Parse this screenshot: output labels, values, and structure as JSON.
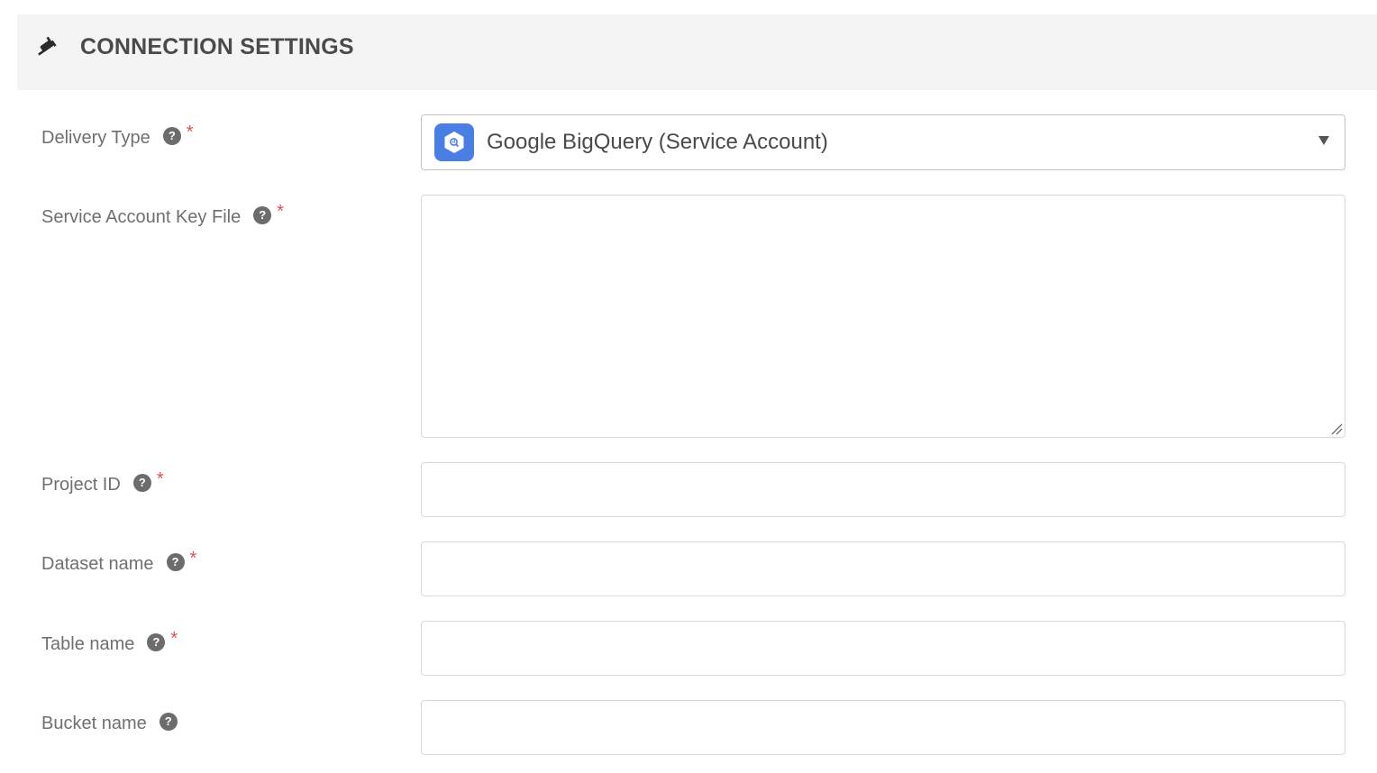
{
  "header": {
    "icon": "plug-icon",
    "title": "CONNECTION SETTINGS"
  },
  "fields": {
    "delivery_type": {
      "label": "Delivery Type",
      "required": "*",
      "help": "?",
      "value": "Google BigQuery (Service Account)",
      "icon": "bigquery-logo-icon"
    },
    "service_account_key_file": {
      "label": "Service Account Key File",
      "required": "*",
      "help": "?",
      "value": ""
    },
    "project_id": {
      "label": "Project ID",
      "required": "*",
      "help": "?",
      "value": ""
    },
    "dataset_name": {
      "label": "Dataset name",
      "required": "*",
      "help": "?",
      "value": ""
    },
    "table_name": {
      "label": "Table name",
      "required": "*",
      "help": "?",
      "value": ""
    },
    "bucket_name": {
      "label": "Bucket name",
      "help": "?",
      "value": ""
    }
  },
  "colors": {
    "header_bg": "#f4f4f4",
    "required": "#d9534f",
    "bigquery_blue": "#4a7ee3"
  }
}
